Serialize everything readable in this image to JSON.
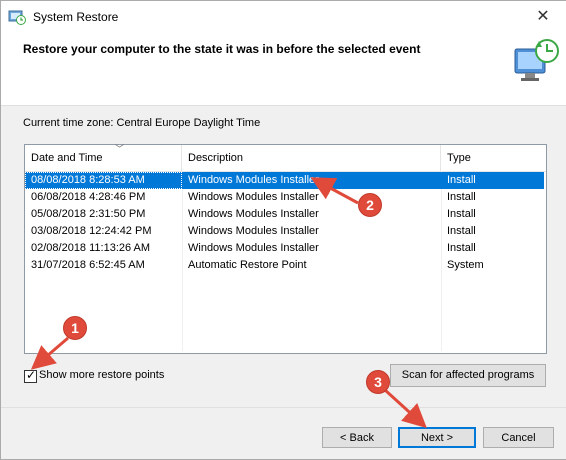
{
  "window": {
    "title": "System Restore",
    "close_glyph": "✕"
  },
  "header": {
    "heading": "Restore your computer to the state it was in before the selected event"
  },
  "timezone_text": "Current time zone: Central Europe Daylight Time",
  "table": {
    "columns": [
      "Date and Time",
      "Description",
      "Type"
    ],
    "rows": [
      {
        "date": "08/08/2018 8:28:53 AM",
        "description": "Windows Modules Installer",
        "type": "Install",
        "selected": true
      },
      {
        "date": "06/08/2018 4:28:46 PM",
        "description": "Windows Modules Installer",
        "type": "Install",
        "selected": false
      },
      {
        "date": "05/08/2018 2:31:50 PM",
        "description": "Windows Modules Installer",
        "type": "Install",
        "selected": false
      },
      {
        "date": "03/08/2018 12:24:42 PM",
        "description": "Windows Modules Installer",
        "type": "Install",
        "selected": false
      },
      {
        "date": "02/08/2018 11:13:26 AM",
        "description": "Windows Modules Installer",
        "type": "Install",
        "selected": false
      },
      {
        "date": "31/07/2018 6:52:45 AM",
        "description": "Automatic Restore Point",
        "type": "System",
        "selected": false
      }
    ]
  },
  "show_more": {
    "label": "Show more restore points",
    "checked": true,
    "check_glyph": "✓"
  },
  "buttons": {
    "scan": "Scan for affected programs",
    "back": "< Back",
    "next": "Next >",
    "cancel": "Cancel"
  },
  "annotations": {
    "marker_1": "1",
    "marker_2": "2",
    "marker_3": "3"
  },
  "colors": {
    "selection": "#0078d7",
    "annotation": "#e04a3a"
  }
}
